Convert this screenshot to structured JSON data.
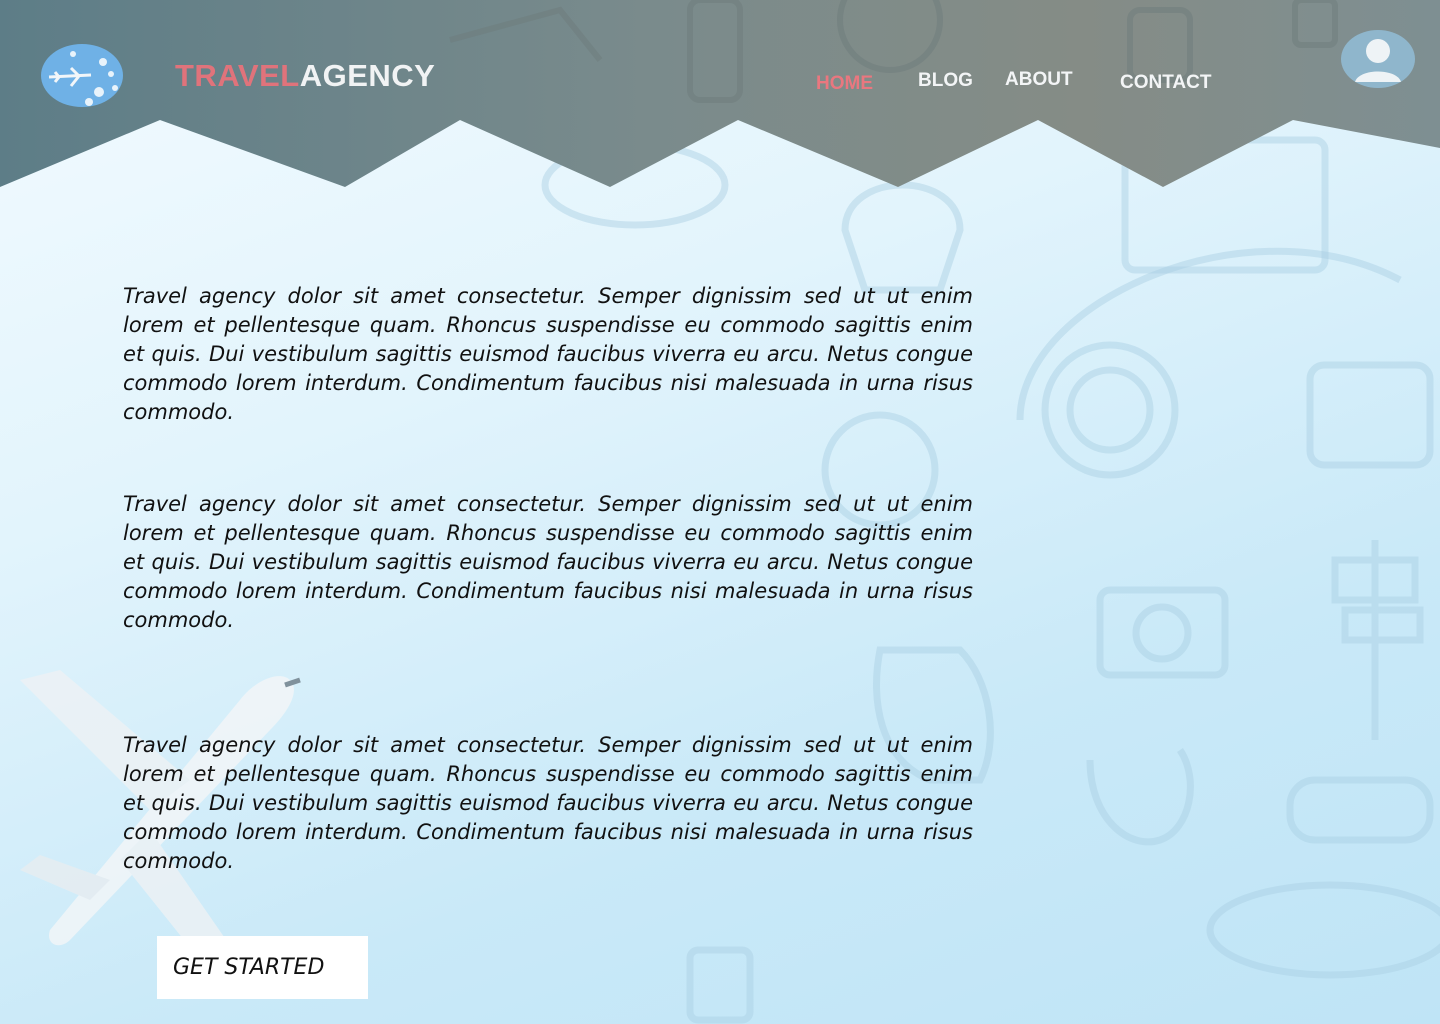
{
  "brand": {
    "part1": "TRAVEL",
    "part2": "AGENCY"
  },
  "nav": [
    {
      "label": "HOME",
      "active": true
    },
    {
      "label": "BLOG",
      "active": false
    },
    {
      "label": "ABOUT",
      "active": false
    },
    {
      "label": "CONTACT",
      "active": false
    }
  ],
  "content": {
    "paragraphs": [
      "Travel agency dolor sit amet consectetur. Semper dignissim sed ut ut enim lorem et pellentesque quam. Rhoncus suspendisse eu commodo sagittis enim et quis. Dui vestibulum sagittis euismod faucibus viverra eu arcu. Netus congue commodo lorem interdum. Condimentum faucibus nisi malesuada in urna risus commodo.",
      "Travel agency dolor sit amet consectetur. Semper dignissim sed ut ut enim lorem et pellentesque quam. Rhoncus suspendisse eu commodo sagittis enim et quis. Dui vestibulum sagittis euismod faucibus viverra eu arcu. Netus congue commodo lorem interdum. Condimentum faucibus nisi malesuada in urna risus commodo.",
      "Travel agency dolor sit amet consectetur. Semper dignissim sed ut ut enim lorem et pellentesque quam. Rhoncus suspendisse eu commodo sagittis enim et quis. Dui vestibulum sagittis euismod faucibus viverra eu arcu. Netus congue commodo lorem interdum. Condimentum faucibus nisi malesuada in urna risus commodo."
    ],
    "cta_label": "GET STARTED"
  },
  "icons": {
    "logo": "airplane-globe-icon",
    "user": "user-avatar-icon"
  },
  "colors": {
    "header": "#7f8f92",
    "accent": "#e0737b",
    "nav_text": "#f3f5f6",
    "logo_bg": "#6fb1e6"
  }
}
